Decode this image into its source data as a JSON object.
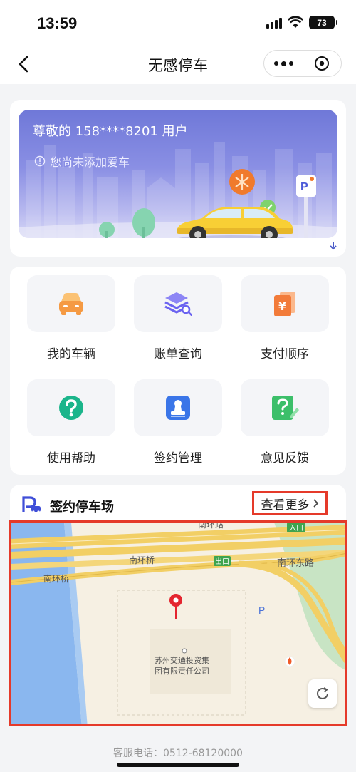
{
  "status_bar": {
    "time": "13:59",
    "battery": "73"
  },
  "nav": {
    "title": "无感停车"
  },
  "banner": {
    "greeting": "尊敬的 158****8201 用户",
    "notice": "您尚未添加爱车"
  },
  "grid": {
    "items": [
      {
        "label": "我的车辆",
        "icon": "car-icon",
        "color": "#f59a43"
      },
      {
        "label": "账单查询",
        "icon": "bill-search-icon",
        "color": "#6b63f0"
      },
      {
        "label": "支付顺序",
        "icon": "payment-order-icon",
        "color": "#f27b3a"
      },
      {
        "label": "使用帮助",
        "icon": "help-icon",
        "color": "#1bb58b"
      },
      {
        "label": "签约管理",
        "icon": "contract-icon",
        "color": "#3a75e8"
      },
      {
        "label": "意见反馈",
        "icon": "feedback-icon",
        "color": "#3cbf6a"
      }
    ]
  },
  "parking": {
    "title": "签约停车场",
    "view_more": "查看更多",
    "map": {
      "labels": {
        "south_ring_bridge_left": "南环桥",
        "south_ring_bridge": "南环桥",
        "south_ring_road_top": "南环路",
        "south_ring_east_road": "南环东路",
        "entrance": "入口",
        "exit": "出口",
        "parking": "P",
        "company_line1": "苏州交通投资集",
        "company_line2": "团有限责任公司"
      }
    }
  },
  "footer": {
    "phone": "客服电话：0512-68120000"
  }
}
